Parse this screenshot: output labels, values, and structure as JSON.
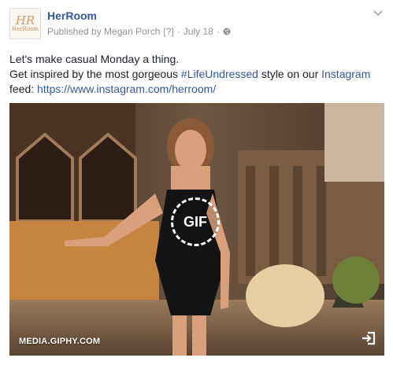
{
  "post": {
    "page_name": "HerRoom",
    "logo_text": "HerRoom",
    "logo_mark": "HR",
    "published_by": "Published by Megan Porch",
    "help_marker": "[?]",
    "separator": "·",
    "date": "July 18",
    "separator2": "·",
    "audience_icon": "globe-icon",
    "menu_icon": "chevron-down-icon"
  },
  "message": {
    "line1": "Let's make casual Monday a thing.",
    "line2_pre": "Get inspired by the most gorgeous ",
    "hashtag": "#LifeUndressed",
    "line2_mid": " style on our ",
    "instagram": "Instagram",
    "line3_pre": "feed: ",
    "url": "https://www.instagram.com/herroom/"
  },
  "media": {
    "badge": "GIF",
    "source": "MEDIA.GIPHY.COM",
    "open_icon": "open-external-icon"
  }
}
